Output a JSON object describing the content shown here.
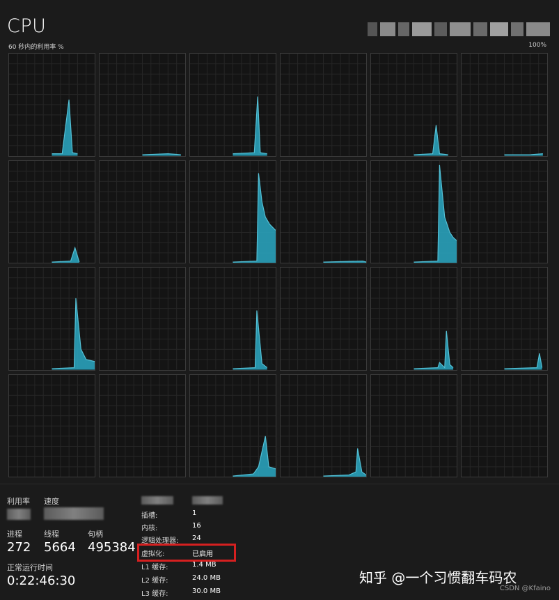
{
  "window": {
    "title": "CPU"
  },
  "graph": {
    "caption_left": "60 秒内的利用率 %",
    "caption_right": "100%",
    "line_color": "#55c1d6",
    "fill_color": "#2aa9c4",
    "rows": 4,
    "cols": 6,
    "cores": [
      [
        [
          0.5,
          0.02
        ],
        [
          0.62,
          0.02
        ],
        [
          0.7,
          0.55
        ],
        [
          0.74,
          0.03
        ],
        [
          0.8,
          0.02
        ]
      ],
      [
        [
          0.5,
          0.01
        ],
        [
          0.8,
          0.02
        ],
        [
          0.95,
          0.01
        ]
      ],
      [
        [
          0.5,
          0.02
        ],
        [
          0.75,
          0.03
        ],
        [
          0.79,
          0.58
        ],
        [
          0.82,
          0.03
        ],
        [
          0.9,
          0.02
        ]
      ],
      [
        [
          0.5,
          0.01
        ]
      ],
      [
        [
          0.5,
          0.01
        ],
        [
          0.72,
          0.02
        ],
        [
          0.76,
          0.3
        ],
        [
          0.8,
          0.02
        ],
        [
          0.9,
          0.01
        ]
      ],
      [
        [
          0.5,
          0.01
        ],
        [
          0.8,
          0.01
        ],
        [
          0.95,
          0.02
        ]
      ],
      [
        [
          0.5,
          0.01
        ],
        [
          0.72,
          0.02
        ],
        [
          0.77,
          0.15
        ],
        [
          0.82,
          0.01
        ]
      ],
      [
        [
          0.5,
          0.01
        ]
      ],
      [
        [
          0.5,
          0.01
        ],
        [
          0.78,
          0.02
        ],
        [
          0.8,
          0.88
        ],
        [
          0.84,
          0.6
        ],
        [
          0.88,
          0.45
        ],
        [
          0.93,
          0.38
        ],
        [
          1.0,
          0.32
        ]
      ],
      [
        [
          0.5,
          0.01
        ],
        [
          0.96,
          0.02
        ],
        [
          1.0,
          0.01
        ]
      ],
      [
        [
          0.5,
          0.01
        ],
        [
          0.78,
          0.02
        ],
        [
          0.8,
          0.96
        ],
        [
          0.86,
          0.45
        ],
        [
          0.92,
          0.3
        ],
        [
          0.96,
          0.25
        ],
        [
          1.0,
          0.22
        ]
      ],
      [
        [
          0.5,
          0.01
        ]
      ],
      [
        [
          0.5,
          0.01
        ],
        [
          0.76,
          0.02
        ],
        [
          0.78,
          0.7
        ],
        [
          0.84,
          0.2
        ],
        [
          0.9,
          0.1
        ],
        [
          1.0,
          0.08
        ]
      ],
      [
        [
          0.5,
          0.01
        ]
      ],
      [
        [
          0.5,
          0.01
        ],
        [
          0.76,
          0.02
        ],
        [
          0.78,
          0.58
        ],
        [
          0.84,
          0.06
        ],
        [
          0.9,
          0.02
        ]
      ],
      [
        [
          0.5,
          0.01
        ]
      ],
      [
        [
          0.5,
          0.01
        ],
        [
          0.78,
          0.02
        ],
        [
          0.8,
          0.07
        ],
        [
          0.86,
          0.02
        ],
        [
          0.88,
          0.38
        ],
        [
          0.92,
          0.05
        ],
        [
          0.96,
          0.02
        ]
      ],
      [
        [
          0.5,
          0.01
        ],
        [
          0.88,
          0.02
        ],
        [
          0.91,
          0.16
        ],
        [
          0.94,
          0.02
        ]
      ],
      [
        [
          0.5,
          0.01
        ]
      ],
      [
        [
          0.5,
          0.01
        ]
      ],
      [
        [
          0.5,
          0.01
        ],
        [
          0.74,
          0.03
        ],
        [
          0.8,
          0.1
        ],
        [
          0.88,
          0.4
        ],
        [
          0.92,
          0.1
        ],
        [
          1.0,
          0.08
        ]
      ],
      [
        [
          0.5,
          0.01
        ],
        [
          0.8,
          0.02
        ],
        [
          0.88,
          0.05
        ],
        [
          0.9,
          0.28
        ],
        [
          0.95,
          0.05
        ],
        [
          1.0,
          0.02
        ]
      ],
      [
        [
          0.5,
          0.01
        ]
      ],
      [
        [
          0.5,
          0.01
        ]
      ]
    ]
  },
  "stats": {
    "utilization_label": "利用率",
    "speed_label": "速度",
    "processes_label": "进程",
    "processes_value": "272",
    "threads_label": "线程",
    "threads_value": "5664",
    "handles_label": "句柄",
    "handles_value": "495384",
    "uptime_label": "正常运行时间",
    "uptime_value": "0:22:46:30"
  },
  "info": [
    {
      "key": "插槽:",
      "value": "1"
    },
    {
      "key": "内核:",
      "value": "16"
    },
    {
      "key": "逻辑处理器:",
      "value": "24"
    },
    {
      "key": "虚拟化:",
      "value": "已启用"
    },
    {
      "key": "L1 缓存:",
      "value": "1.4 MB"
    },
    {
      "key": "L2 缓存:",
      "value": "24.0 MB"
    },
    {
      "key": "L3 缓存:",
      "value": "30.0 MB"
    }
  ],
  "watermark": {
    "text": "知乎 @一个习惯翻车码农",
    "source": "CSDN @Kfaino"
  }
}
